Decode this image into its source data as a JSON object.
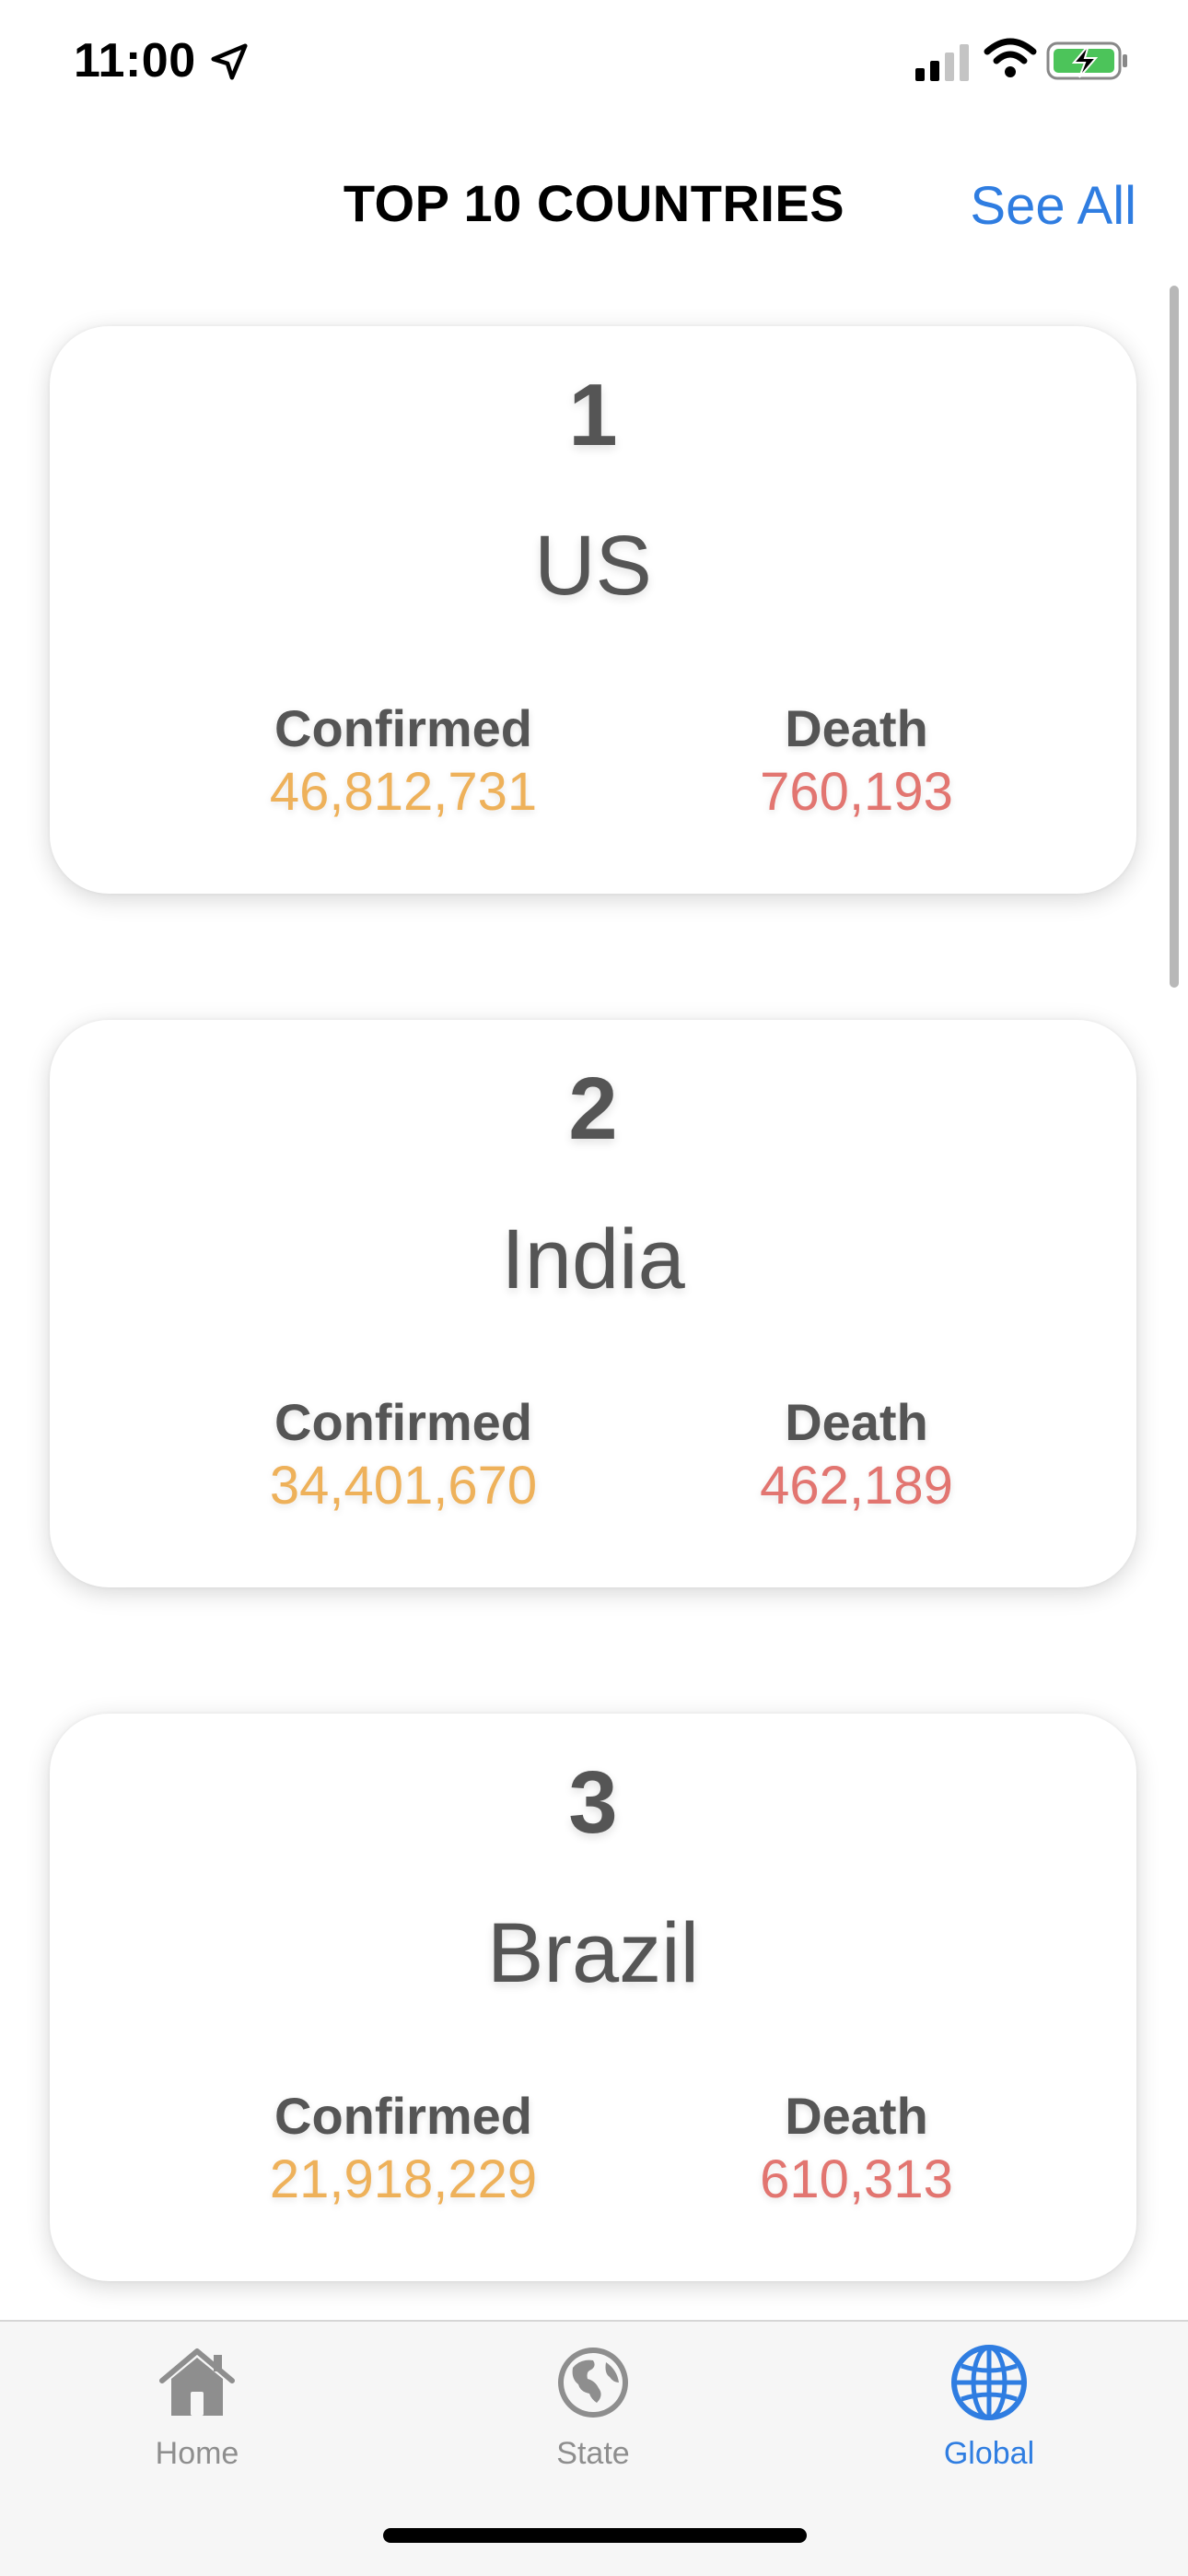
{
  "status_bar": {
    "time": "11:00",
    "icons": [
      "location-arrow-icon",
      "cellular-signal-icon",
      "wifi-icon",
      "battery-charging-icon"
    ]
  },
  "header": {
    "title": "TOP 10 COUNTRIES",
    "see_all_label": "See All",
    "accent_color": "#2f7de1"
  },
  "countries": [
    {
      "rank": "1",
      "name": "US",
      "confirmed_label": "Confirmed",
      "confirmed": "46,812,731",
      "death_label": "Death",
      "death": "760,193"
    },
    {
      "rank": "2",
      "name": "India",
      "confirmed_label": "Confirmed",
      "confirmed": "34,401,670",
      "death_label": "Death",
      "death": "462,189"
    },
    {
      "rank": "3",
      "name": "Brazil",
      "confirmed_label": "Confirmed",
      "confirmed": "21,918,229",
      "death_label": "Death",
      "death": "610,313"
    }
  ],
  "colors": {
    "confirmed": "#eeb15a",
    "death": "#e27570",
    "text_dark": "#555555"
  },
  "tab_bar": {
    "tabs": [
      {
        "label": "Home",
        "icon": "house-icon",
        "active": false
      },
      {
        "label": "State",
        "icon": "globe-americas-icon",
        "active": false
      },
      {
        "label": "Global",
        "icon": "globe-grid-icon",
        "active": true
      }
    ]
  }
}
